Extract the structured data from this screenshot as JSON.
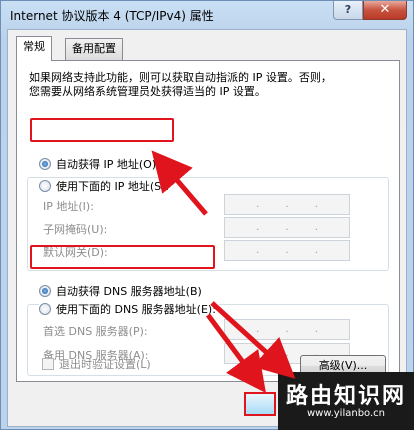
{
  "window": {
    "title": "Internet 协议版本 4 (TCP/IPv4) 属性",
    "help_label": "?",
    "close_label": "✕"
  },
  "tabs": [
    {
      "label": "常规"
    },
    {
      "label": "备用配置"
    }
  ],
  "description": {
    "line1": "如果网络支持此功能，则可以获取自动指派的 IP 设置。否则，",
    "line2": "您需要从网络系统管理员处获得适当的 IP 设置。"
  },
  "ip": {
    "auto_label": "自动获得 IP 地址(O)",
    "manual_label": "使用下面的 IP 地址(S):",
    "fields": [
      {
        "label": "IP 地址(I):"
      },
      {
        "label": "子网掩码(U):"
      },
      {
        "label": "默认网关(D):"
      }
    ]
  },
  "dns": {
    "auto_label": "自动获得 DNS 服务器地址(B)",
    "manual_label": "使用下面的 DNS 服务器地址(E):",
    "fields": [
      {
        "label": "首选 DNS 服务器(P):"
      },
      {
        "label": "备用 DNS 服务器(A):"
      }
    ]
  },
  "validate_label": "退出时验证设置(L)",
  "advanced_label": "高级(V)...",
  "watermark": {
    "title": "路由知识网",
    "url": "www.yilanbo.cn"
  },
  "colors": {
    "highlight": "#e0141d",
    "disabled_text": "#8d8d8d"
  }
}
